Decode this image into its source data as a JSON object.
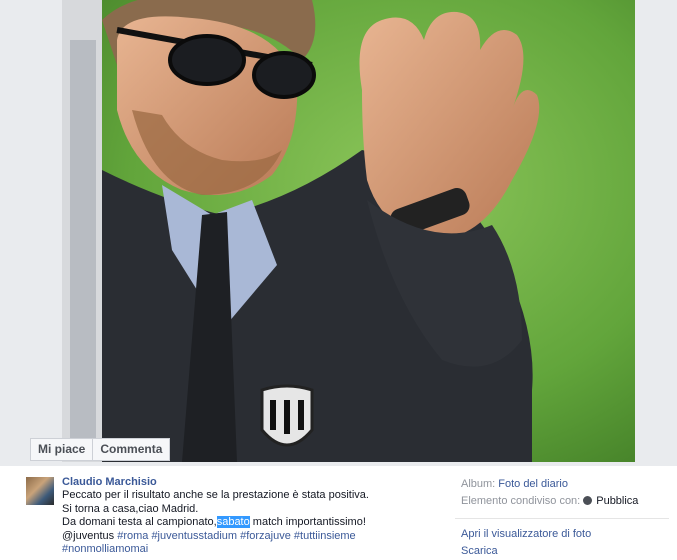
{
  "photo_actions": {
    "like": "Mi piace",
    "comment": "Commenta"
  },
  "post": {
    "author": "Claudio Marchisio",
    "lines": {
      "l1": "Peccato per il risultato anche se la prestazione è stata positiva.",
      "l2": "Si torna a casa,ciao Madrid.",
      "l3_a": "Da domani testa al campionato,",
      "l3_hl": "sabato",
      "l3_b": " match importantissimo!",
      "l4_a": "@juventus ",
      "l4_tags": "#roma #juventusstadium #forzajuve #tuttiinsieme",
      "l5_tags": "#nonmolliamomai"
    }
  },
  "side": {
    "album_label": "Album:",
    "album_value": "Foto del diario",
    "shared_label": "Elemento condiviso con:",
    "privacy": "Pubblica",
    "open_viewer": "Apri il visualizzatore di foto",
    "download": "Scarica"
  },
  "colors": {
    "link": "#3b5998",
    "selection": "#3399ff",
    "photo_background": "#63a83b"
  },
  "icons": {
    "privacy": "globe-icon"
  }
}
